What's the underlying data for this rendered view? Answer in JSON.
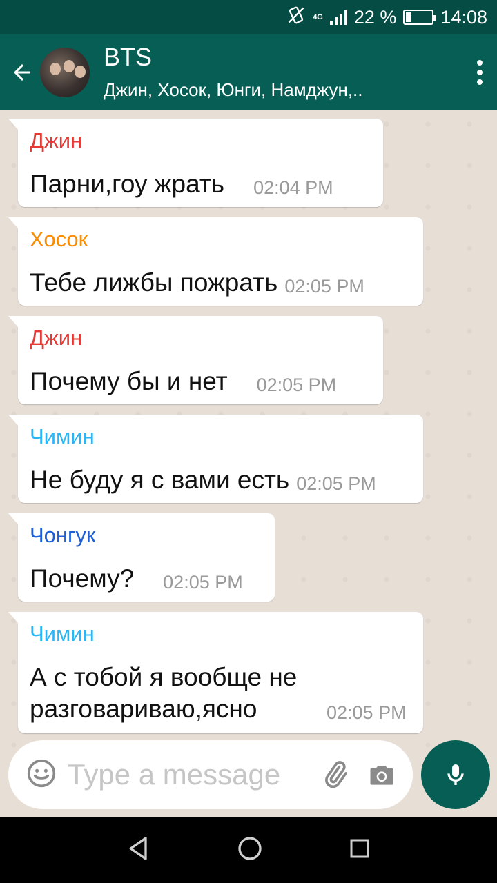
{
  "status_bar": {
    "network": "4G",
    "battery_percent": "22 %",
    "battery_level": 0.22,
    "time": "14:08"
  },
  "header": {
    "title": "BTS",
    "subtitle": "Джин, Хосок, Юнги, Намджун,.."
  },
  "messages": [
    {
      "sender": "Джин",
      "color": "#e53935",
      "text": "Парни,гоу жрать",
      "time": "02:04 PM"
    },
    {
      "sender": "Хосок",
      "color": "#fb8c00",
      "text": "Тебе лижбы пожрать",
      "time": "02:05 PM"
    },
    {
      "sender": "Джин",
      "color": "#e53935",
      "text": "Почему бы и нет",
      "time": "02:05 PM"
    },
    {
      "sender": "Чимин",
      "color": "#29b6f6",
      "text": "Не буду я с вами есть",
      "time": "02:05 PM"
    },
    {
      "sender": "Чонгук",
      "color": "#1e5fd6",
      "text": "Почему?",
      "time": "02:05 PM"
    },
    {
      "sender": "Чимин",
      "color": "#29b6f6",
      "text": "А с тобой я вообще не разговариваю,ясно",
      "time": "02:05 PM"
    }
  ],
  "input": {
    "placeholder": "Type a message"
  },
  "icons": {
    "back": "arrow-left-icon",
    "menu": "more-vert-icon",
    "emoji": "emoji-icon",
    "attach": "paperclip-icon",
    "camera": "camera-icon",
    "mic": "mic-icon"
  },
  "colors": {
    "header": "#075e54",
    "status_bar": "#054d44",
    "chat_background": "#e5ddd5",
    "bubble": "#ffffff",
    "timestamp": "#9a9a9a"
  }
}
